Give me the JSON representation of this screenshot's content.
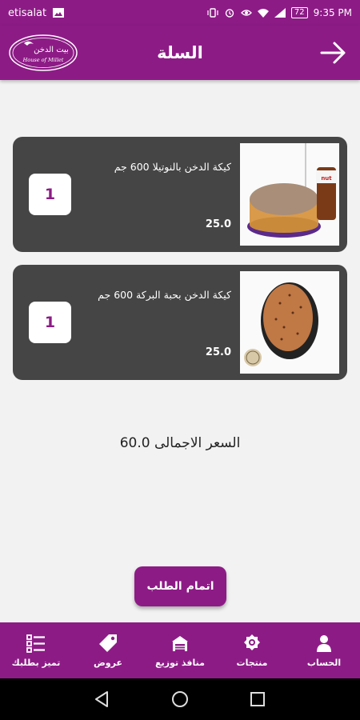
{
  "status_bar": {
    "carrier": "etisalat",
    "battery": "72",
    "time": "9:35 PM"
  },
  "header": {
    "title": "السلة",
    "logo_text_ar": "بيت الدخن",
    "logo_text_en": "House of Millet"
  },
  "cart": {
    "items": [
      {
        "name": "كيكة الدخن بالنوتيلا 600 جم",
        "price": "25.0",
        "quantity": "1",
        "image_icon": "nutella-cake-image"
      },
      {
        "name": "كيكة الدخن بحبة البركة 600 جم",
        "price": "25.0",
        "quantity": "1",
        "image_icon": "black-seed-cake-image"
      }
    ],
    "total_label": "السعر الاجمالى",
    "total_value": "60.0"
  },
  "checkout_label": "اتمام الطلب",
  "bottom_nav": [
    {
      "label": "الحساب",
      "icon": "person-icon"
    },
    {
      "label": "منتجات",
      "icon": "products-icon"
    },
    {
      "label": "منافذ توزيع",
      "icon": "store-icon"
    },
    {
      "label": "عروض",
      "icon": "tag-icon"
    },
    {
      "label": "تميز بطلبك",
      "icon": "list-icon"
    }
  ],
  "colors": {
    "primary": "#8d1b86",
    "card": "#454545",
    "background": "#f2f2f2"
  }
}
